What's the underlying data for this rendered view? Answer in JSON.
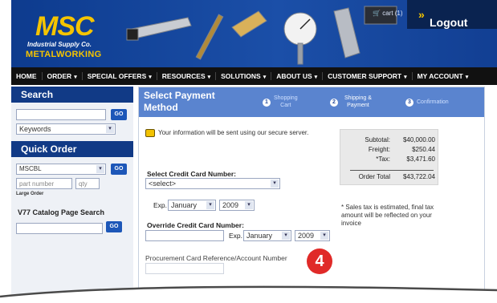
{
  "brand": {
    "logo_text": "MSC",
    "tagline": "Industrial Supply Co.",
    "division": "METALWORKING",
    "brand_blue": "#0d3b8e",
    "brand_yellow": "#f5c400"
  },
  "header": {
    "cart_label": "cart (1)",
    "logout_label": "Logout",
    "logout_arrow": "»"
  },
  "nav": {
    "items": [
      {
        "label": "HOME"
      },
      {
        "label": "ORDER"
      },
      {
        "label": "SPECIAL OFFERS"
      },
      {
        "label": "RESOURCES"
      },
      {
        "label": "SOLUTIONS"
      },
      {
        "label": "ABOUT US"
      },
      {
        "label": "CUSTOMER SUPPORT"
      },
      {
        "label": "MY ACCOUNT"
      }
    ]
  },
  "sidebar": {
    "search_title": "Search",
    "search_go": "GO",
    "search_scope": "Keywords",
    "quick_order_title": "Quick Order",
    "quick_select": "MSCBL",
    "quick_go": "GO",
    "part_placeholder": "part number",
    "qty_placeholder": "qty",
    "large_order_label": "Large Order",
    "catalog_title": "V77 Catalog Page Search",
    "catalog_go": "GO"
  },
  "main": {
    "title_line1": "Select Payment",
    "title_line2": "Method",
    "steps": [
      {
        "number": "1",
        "label_line1": "Shopping",
        "label_line2": "Cart"
      },
      {
        "number": "2",
        "label_line1": "Shipping &",
        "label_line2": "Payment"
      },
      {
        "number": "3",
        "label_line1": "Confirmation",
        "label_line2": ""
      }
    ],
    "secure_note": "Your information will be sent using our secure server.",
    "cc_select_label": "Select Credit Card Number:",
    "cc_select_value": "<select>",
    "exp_label": "Exp.",
    "exp_month": "January",
    "exp_year": "2009",
    "override_label": "Override Credit Card Number:",
    "override_exp_label": "Exp.",
    "override_exp_month": "January",
    "override_exp_year": "2009",
    "procurement_label": "Procurement Card Reference/Account Number"
  },
  "summary": {
    "subtotal_label": "Subtotal:",
    "subtotal_value": "$40,000.00",
    "freight_label": "Freight:",
    "freight_value": "$250.44",
    "tax_label": "*Tax:",
    "tax_value": "$3,471.60",
    "total_label": "Order Total",
    "total_value": "$43,722.04",
    "disclaimer": "* Sales tax is estimated, final tax amount will be reflected on your invoice"
  },
  "callout": {
    "number": "4",
    "color": "#e02a28"
  }
}
